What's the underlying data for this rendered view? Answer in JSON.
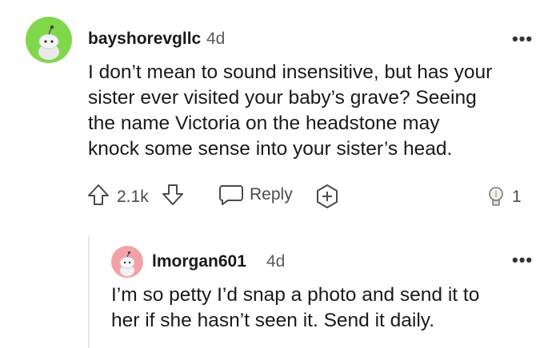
{
  "comment": {
    "username": "bayshorevgllc",
    "time": "4d",
    "text_lines": [
      "I don’t mean to sound insensitive, but has your",
      "sister ever visited your baby’s grave? Seeing",
      "the name Victoria on the headstone may",
      "knock some sense into your sister’s head."
    ],
    "votes": "2.1k",
    "reply_label": "Reply",
    "award_count": "1",
    "avatar_color": "#7fd84a",
    "menu_icon": "more-options-icon"
  },
  "reply": {
    "username": "lmorgan601",
    "time": "4d",
    "text_lines": [
      "I’m so petty I’d snap a photo and send it to",
      "her if she hasn’t seen it. Send it daily."
    ],
    "avatar_color": "#f3a0a8",
    "menu_icon": "more-options-icon"
  }
}
